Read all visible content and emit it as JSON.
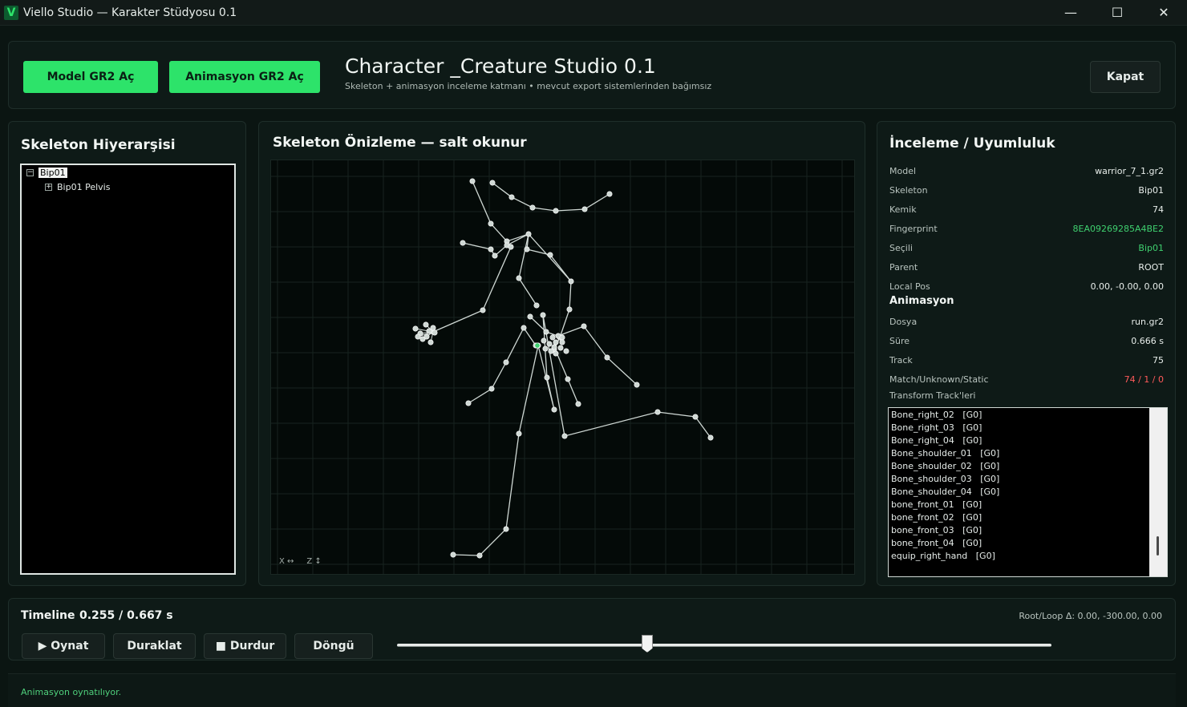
{
  "window": {
    "app_icon": "V",
    "title": "Viello Studio — Karakter Stüdyosu 0.1",
    "minimize": "—",
    "maximize": "☐",
    "close": "✕"
  },
  "header": {
    "open_model_label": "Model GR2 Aç",
    "open_anim_label": "Animasyon GR2 Aç",
    "title": "Character _Creature Studio 0.1",
    "subtitle": "Skeleton + animasyon inceleme katmanı • mevcut export sistemlerinden bağımsız",
    "close_label": "Kapat"
  },
  "hierarchy": {
    "title": "Skeleton Hiyerarşisi",
    "nodes": [
      {
        "label": "Bip01",
        "expander": "−",
        "selected": true
      },
      {
        "label": "Bip01 Pelvis",
        "expander": "+",
        "selected": false
      }
    ]
  },
  "preview": {
    "title": "Skeleton Önizleme — salt okunur",
    "axis_x": "X ↔",
    "axis_z": "Z ↕"
  },
  "inspect": {
    "title": "İnceleme / Uyumluluk",
    "model_rows": [
      {
        "key": "Model",
        "value": "warrior_7_1.gr2",
        "color": "#e8eeeb"
      },
      {
        "key": "Skeleton",
        "value": "Bip01",
        "color": "#e8eeeb"
      },
      {
        "key": "Kemik",
        "value": "74",
        "color": "#e8eeeb"
      },
      {
        "key": "Fingerprint",
        "value": "8EA09269285A4BE2",
        "color": "#3fd06f"
      },
      {
        "key": "Seçili",
        "value": "Bip01",
        "color": "#3fd06f"
      },
      {
        "key": "Parent",
        "value": "ROOT",
        "color": "#e8eeeb"
      },
      {
        "key": "Local Pos",
        "value": "0.00, -0.00, 0.00",
        "color": "#e8eeeb"
      }
    ],
    "animation_heading": "Animasyon",
    "anim_rows": [
      {
        "key": "Dosya",
        "value": "run.gr2",
        "color": "#e8eeeb"
      },
      {
        "key": "Süre",
        "value": "0.666 s",
        "color": "#e8eeeb"
      },
      {
        "key": "Track",
        "value": "75",
        "color": "#e8eeeb"
      },
      {
        "key": "Match/Unknown/Static",
        "value": "74 / 1 / 0",
        "color": "#ff5a5a"
      }
    ],
    "tracks_label": "Transform Track'leri",
    "tracks": [
      "Bone_right_02   [G0]",
      "Bone_right_03   [G0]",
      "Bone_right_04   [G0]",
      "Bone_shoulder_01   [G0]",
      "Bone_shoulder_02   [G0]",
      "Bone_shoulder_03   [G0]",
      "Bone_shoulder_04   [G0]",
      "bone_front_01   [G0]",
      "bone_front_02   [G0]",
      "bone_front_03   [G0]",
      "bone_front_04   [G0]",
      "equip_right_hand   [G0]"
    ]
  },
  "timeline": {
    "label": "Timeline",
    "time": "0.255 / 0.667 s",
    "root_loop": "Root/Loop Δ: 0.00, -300.00, 0.00",
    "play_label": "▶ Oynat",
    "pause_label": "Duraklat",
    "stop_label": "■ Durdur",
    "loop_label": "Döngü",
    "progress": 0.3823
  },
  "status": {
    "text": "Animasyon oynatılıyor."
  },
  "colors": {
    "accent": "#2de36a",
    "bone": "#cfd8d4",
    "selected_joint": "#3fd06f",
    "grid": "#17231f"
  }
}
